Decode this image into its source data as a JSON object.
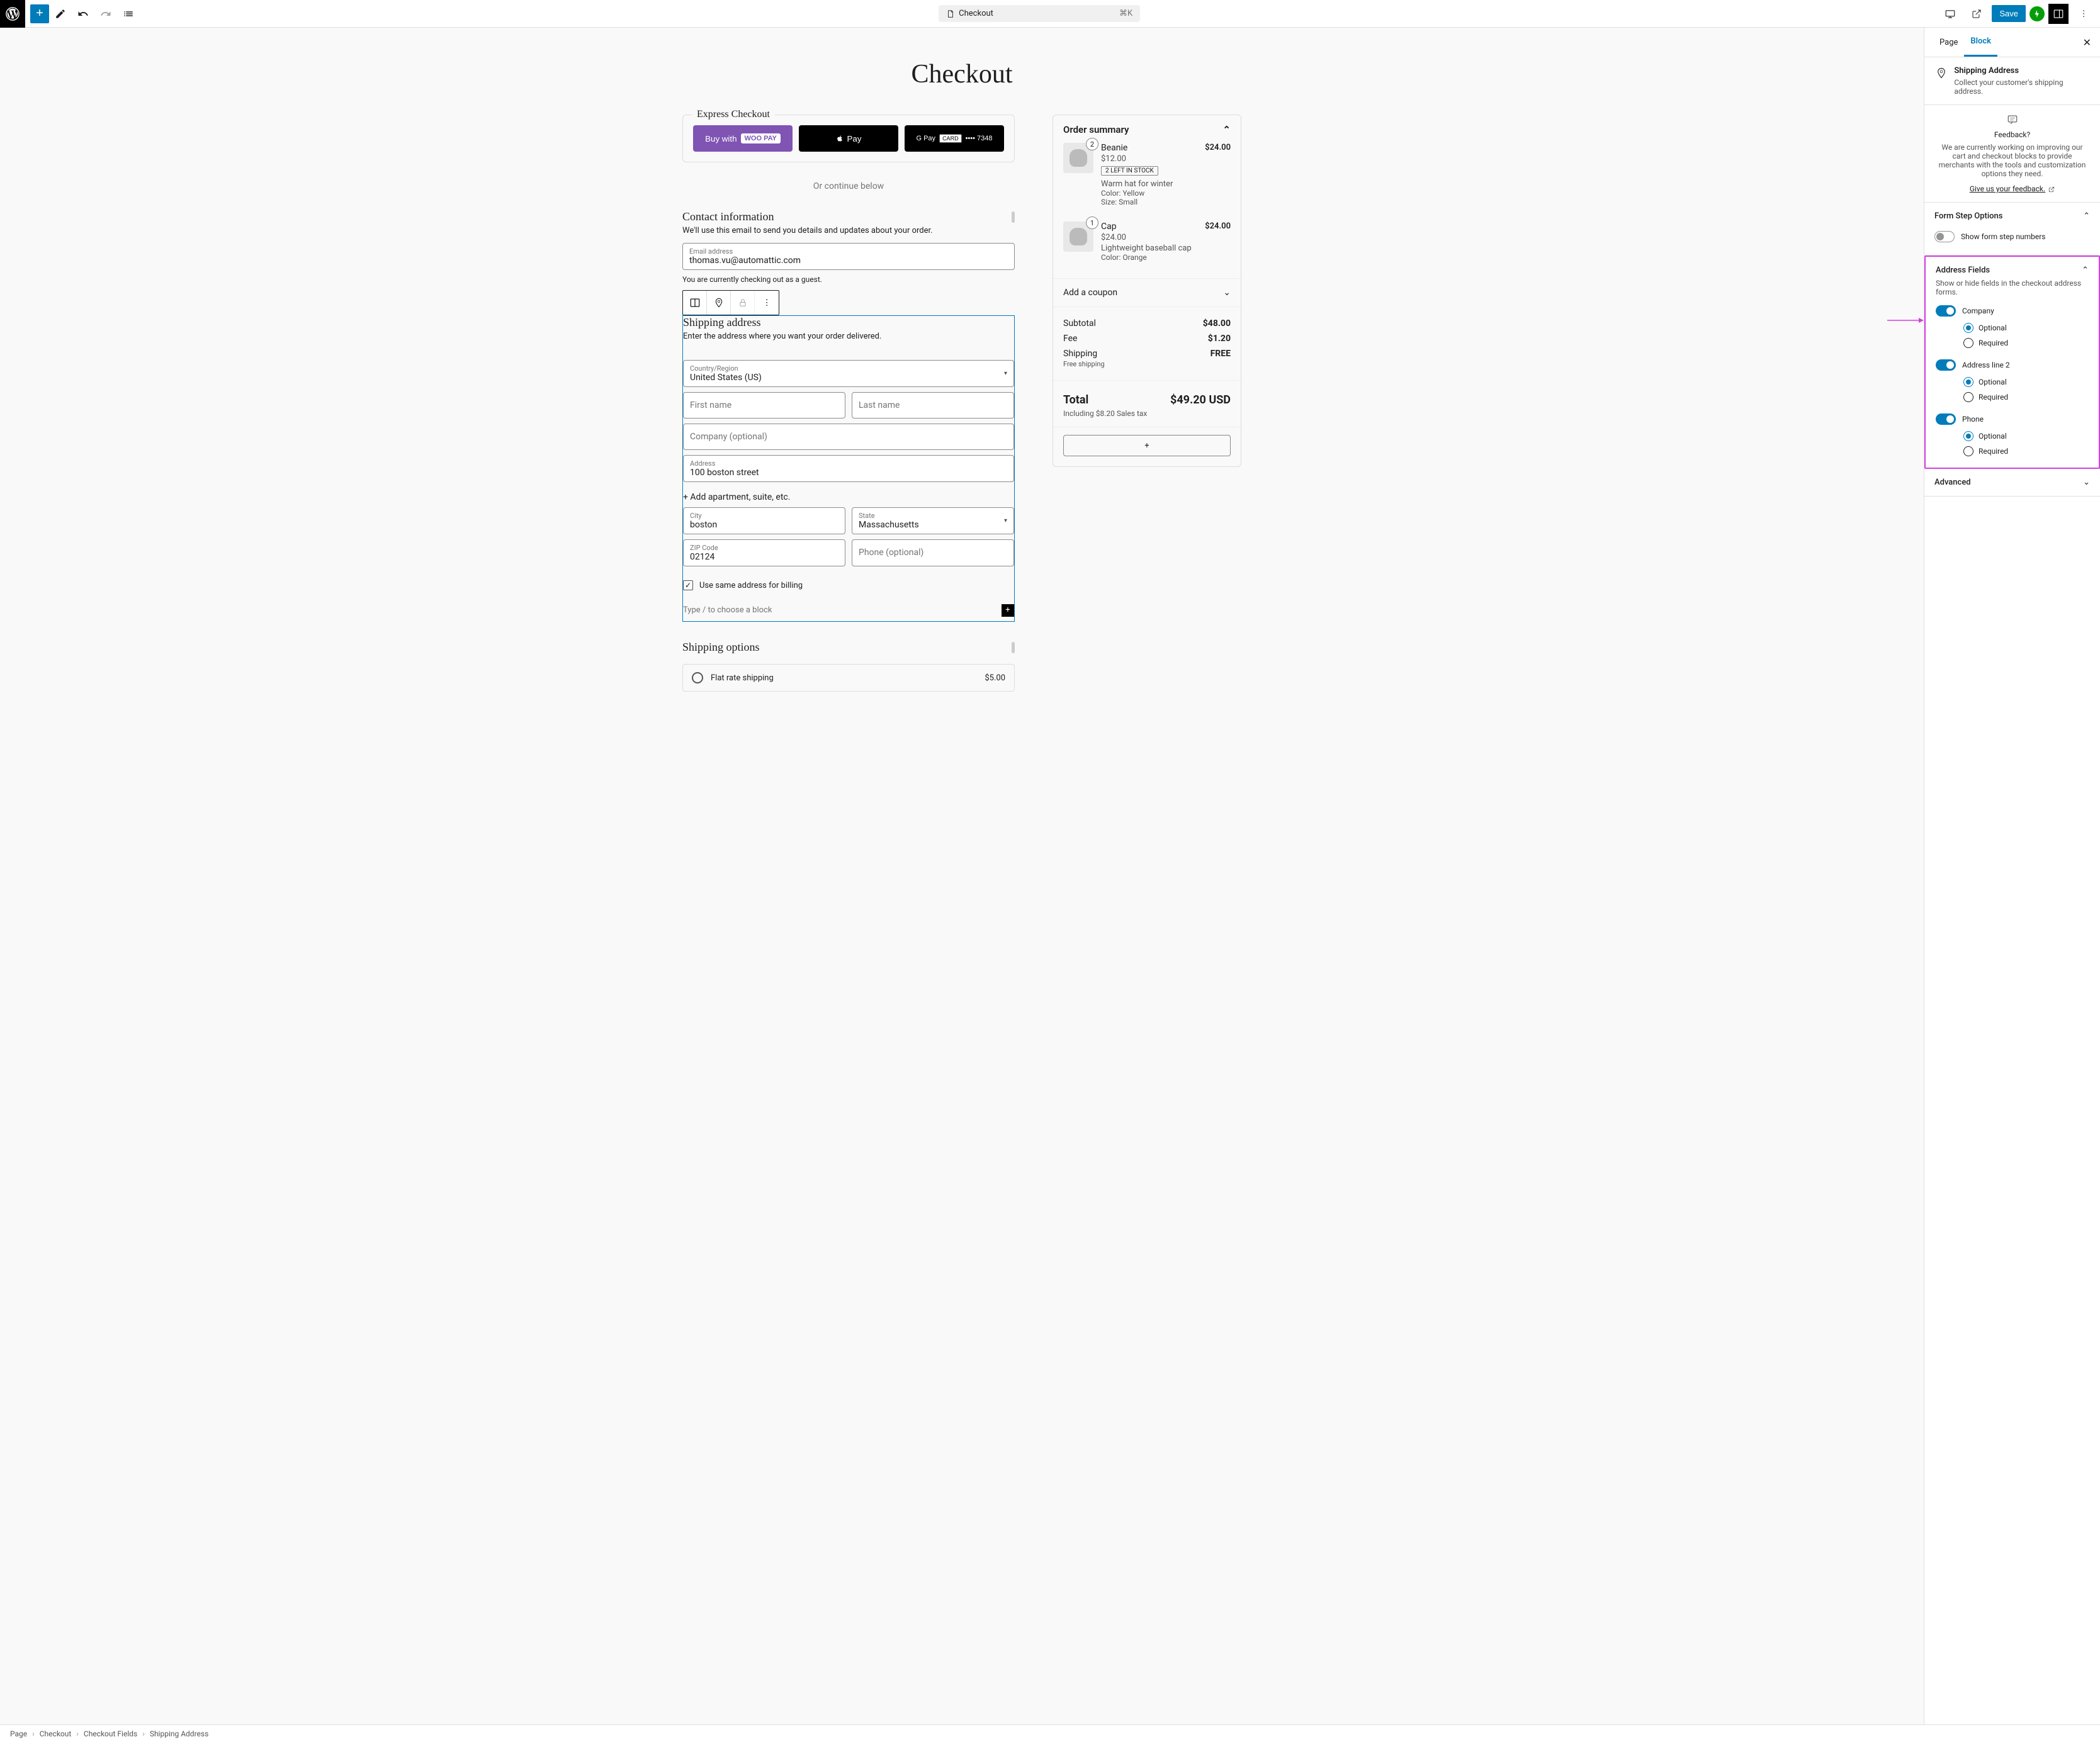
{
  "top_bar": {
    "page_selector_label": "Checkout",
    "page_selector_shortcut": "⌘K",
    "save_label": "Save"
  },
  "page_title": "Checkout",
  "express": {
    "title": "Express Checkout",
    "woopay_prefix": "Buy with",
    "woopay_badge": "WOO PAY",
    "applepay": "Pay",
    "gpay_prefix": "G Pay",
    "gpay_card": "CARD",
    "gpay_last4": "•••• 7348"
  },
  "divider": "Or continue below",
  "contact": {
    "heading": "Contact information",
    "desc": "We'll use this email to send you details and updates about your order.",
    "email_label": "Email address",
    "email_value": "thomas.vu@automattic.com",
    "guest_note": "You are currently checking out as a guest."
  },
  "shipping": {
    "heading": "Shipping address",
    "desc": "Enter the address where you want your order delivered.",
    "country_label": "Country/Region",
    "country_value": "United States (US)",
    "first_name_ph": "First name",
    "last_name_ph": "Last name",
    "company_ph": "Company (optional)",
    "address_label": "Address",
    "address_value": "100 boston street",
    "apt_link": "+ Add apartment, suite, etc.",
    "city_label": "City",
    "city_value": "boston",
    "state_label": "State",
    "state_value": "Massachusetts",
    "zip_label": "ZIP Code",
    "zip_value": "02124",
    "phone_ph": "Phone (optional)",
    "same_billing": "Use same address for billing",
    "type_prompt": "Type / to choose a block"
  },
  "shipping_options": {
    "heading": "Shipping options",
    "flat_label": "Flat rate shipping",
    "flat_price": "$5.00"
  },
  "order": {
    "title": "Order summary",
    "items": [
      {
        "qty": "2",
        "name": "Beanie",
        "unit": "$12.00",
        "total": "$24.00",
        "stock": "2 LEFT IN STOCK",
        "desc": "Warm hat for winter",
        "meta1": "Color: Yellow",
        "meta2": "Size: Small"
      },
      {
        "qty": "1",
        "name": "Cap",
        "unit": "$24.00",
        "total": "$24.00",
        "stock": "",
        "desc": "Lightweight baseball cap",
        "meta1": "Color: Orange",
        "meta2": ""
      }
    ],
    "coupon": "Add a coupon",
    "subtotal_label": "Subtotal",
    "subtotal": "$48.00",
    "fee_label": "Fee",
    "fee": "$1.20",
    "shipping_label": "Shipping",
    "shipping_value": "FREE",
    "free_shipping": "Free shipping",
    "total_label": "Total",
    "total": "$49.20 USD",
    "tax_note": "Including $8.20 Sales tax"
  },
  "sidebar": {
    "tab_page": "Page",
    "tab_block": "Block",
    "block_title": "Shipping Address",
    "block_subtitle": "Collect your customer's shipping address.",
    "feedback_title": "Feedback?",
    "feedback_text": "We are currently working on improving our cart and checkout blocks to provide merchants with the tools and customization options they need.",
    "feedback_link": "Give us your feedback.",
    "form_step_title": "Form Step Options",
    "show_step_numbers": "Show form step numbers",
    "address_fields_title": "Address Fields",
    "address_fields_desc": "Show or hide fields in the checkout address forms.",
    "company": "Company",
    "address2": "Address line 2",
    "phone": "Phone",
    "optional": "Optional",
    "required": "Required",
    "advanced": "Advanced"
  },
  "breadcrumb": {
    "items": [
      "Page",
      "Checkout",
      "Checkout Fields",
      "Shipping Address"
    ]
  }
}
